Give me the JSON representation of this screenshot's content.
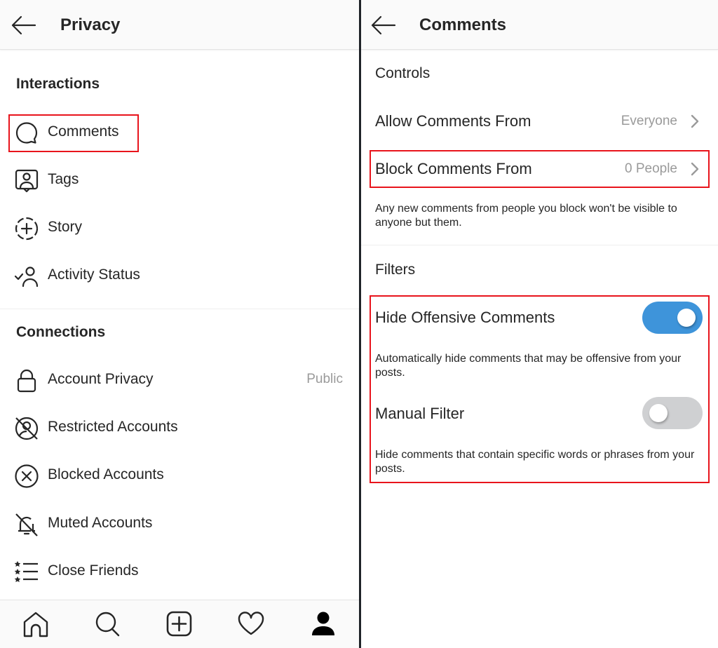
{
  "left": {
    "title": "Privacy",
    "sections": {
      "interactions": {
        "title": "Interactions",
        "items": [
          {
            "label": "Comments",
            "icon": "comment-bubble-icon"
          },
          {
            "label": "Tags",
            "icon": "tag-person-icon"
          },
          {
            "label": "Story",
            "icon": "story-add-icon"
          },
          {
            "label": "Activity Status",
            "icon": "activity-status-icon"
          }
        ]
      },
      "connections": {
        "title": "Connections",
        "items": [
          {
            "label": "Account Privacy",
            "value": "Public",
            "icon": "lock-icon"
          },
          {
            "label": "Restricted Accounts",
            "icon": "restricted-icon"
          },
          {
            "label": "Blocked Accounts",
            "icon": "blocked-icon"
          },
          {
            "label": "Muted Accounts",
            "icon": "muted-bell-icon"
          },
          {
            "label": "Close Friends",
            "icon": "close-friends-icon"
          }
        ]
      }
    },
    "bottom_nav": [
      "home-icon",
      "search-icon",
      "add-post-icon",
      "heart-icon",
      "profile-icon"
    ]
  },
  "right": {
    "title": "Comments",
    "controls": {
      "title": "Controls",
      "allow": {
        "label": "Allow Comments From",
        "value": "Everyone"
      },
      "block": {
        "label": "Block Comments From",
        "value": "0 People"
      },
      "description": "Any new comments from people you block won't be visible to anyone but them."
    },
    "filters": {
      "title": "Filters",
      "hide_offensive": {
        "label": "Hide Offensive Comments",
        "enabled": true,
        "description": "Automatically hide comments that may be offensive from your posts."
      },
      "manual_filter": {
        "label": "Manual Filter",
        "enabled": false,
        "description": "Hide comments that contain specific words or phrases from your posts."
      }
    }
  },
  "colors": {
    "highlight": "#e8141c",
    "toggle_on": "#3e94da",
    "toggle_off": "#cfd0d2"
  }
}
